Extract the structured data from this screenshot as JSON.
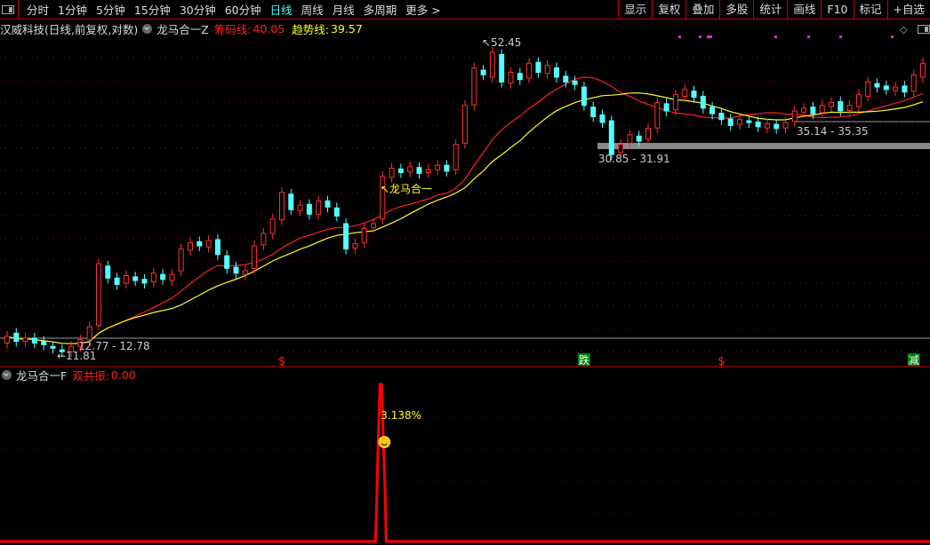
{
  "toolbar": {
    "periods": [
      "分时",
      "1分钟",
      "5分钟",
      "15分钟",
      "30分钟",
      "60分钟",
      "日线",
      "周线",
      "月线",
      "多周期",
      "更多 >"
    ],
    "active_period": "日线",
    "buttons": [
      "显示",
      "复权",
      "叠加",
      "多股",
      "统计",
      "画线",
      "F10",
      "标记",
      "+自选"
    ]
  },
  "info": {
    "stock": "汉威科技(日线,前复权,对数)",
    "indicator": "龙马合一Z",
    "chip_label": "筹码线:",
    "chip_value": "40.05",
    "trend_label": "趋势线:",
    "trend_value": "39.57"
  },
  "sub_info": {
    "indicator": "龙马合一F",
    "label": "双共振:",
    "value": "0.00"
  },
  "colors": {
    "up": "#ff3030",
    "down": "#54ffff",
    "chip_line": "#ff2020",
    "trend_line": "#ffff20",
    "grid": "#8a0000",
    "signal_dot": "#ff20ff",
    "signal_box": "#008000"
  },
  "chart_data": {
    "type": "candlestick",
    "yscale": "log",
    "ylim": [
      11.5,
      56
    ],
    "grid": true,
    "open": [
      12.5,
      13.1,
      12.6,
      12.8,
      12.6,
      12.3,
      12.1,
      12.0,
      12.3,
      12.7,
      13.6,
      18.0,
      17.0,
      16.6,
      17.1,
      16.9,
      16.7,
      17.3,
      16.8,
      17.6,
      19.4,
      20.2,
      19.7,
      20.4,
      18.9,
      17.9,
      17.3,
      17.8,
      19.9,
      21.0,
      22.4,
      25.3,
      23.4,
      24.1,
      23.0,
      24.5,
      23.7,
      22.0,
      19.6,
      20.1,
      21.6,
      22.5,
      27.4,
      28.5,
      28.1,
      28.7,
      28.0,
      28.4,
      29.0,
      28.4,
      32.2,
      38.6,
      45.5,
      44.0,
      49.0,
      42.8,
      44.8,
      43.8,
      47.2,
      44.8,
      46.0,
      44.2,
      43.2,
      42.0,
      38.2,
      36.8,
      35.8,
      30.8,
      32.2,
      33.3,
      32.8,
      34.6,
      38.8,
      37.7,
      40.2,
      41.2,
      40.2,
      38.2,
      37.1,
      36.1,
      35.2,
      35.8,
      35.6,
      34.6,
      35.2,
      34.6,
      35.7,
      37.3,
      38.2,
      37.2,
      38.3,
      39.2,
      37.6,
      38.3,
      40.2,
      42.7,
      42.2,
      41.3,
      42.2,
      41.2,
      44.0
    ],
    "close": [
      12.9,
      12.6,
      12.8,
      12.5,
      12.4,
      12.2,
      12.0,
      12.3,
      12.7,
      13.5,
      18.2,
      17.0,
      16.5,
      17.2,
      16.8,
      16.6,
      17.4,
      16.9,
      17.3,
      19.5,
      20.1,
      19.8,
      20.3,
      19.0,
      17.8,
      17.4,
      17.6,
      19.8,
      21.0,
      22.5,
      25.5,
      23.5,
      24.0,
      23.0,
      24.5,
      23.8,
      22.8,
      19.5,
      20.0,
      21.5,
      22.0,
      27.5,
      28.6,
      28.0,
      28.8,
      27.9,
      28.4,
      29.0,
      28.2,
      32.0,
      38.5,
      46.0,
      44.5,
      49.5,
      43.0,
      45.0,
      43.5,
      47.0,
      45.0,
      46.5,
      44.0,
      43.0,
      42.5,
      38.5,
      36.5,
      35.5,
      30.5,
      32.0,
      33.5,
      32.5,
      34.5,
      39.0,
      37.5,
      40.5,
      41.5,
      40.0,
      38.0,
      37.0,
      36.0,
      35.0,
      36.0,
      35.5,
      34.8,
      35.3,
      34.5,
      35.5,
      37.5,
      38.0,
      37.0,
      38.5,
      39.0,
      37.5,
      38.5,
      40.5,
      43.0,
      42.0,
      41.5,
      42.0,
      41.0,
      44.5,
      47.0
    ],
    "annotations": {
      "high": "52.45",
      "low": "11.81",
      "range1": "12.77 - 12.78",
      "range2": "30.85 - 31.91",
      "range3": "35.14 - 35.35",
      "signal_text": "↖龙马合一"
    },
    "signals": [
      {
        "type": "dollar",
        "label": "$",
        "index": 30
      },
      {
        "type": "box",
        "label": "跌",
        "index": 63
      },
      {
        "type": "dollar",
        "label": "$",
        "index": 78
      },
      {
        "type": "box",
        "label": "减",
        "index": 99
      }
    ],
    "sub": {
      "spike_index": 41,
      "spike_label": "3.138%"
    }
  }
}
